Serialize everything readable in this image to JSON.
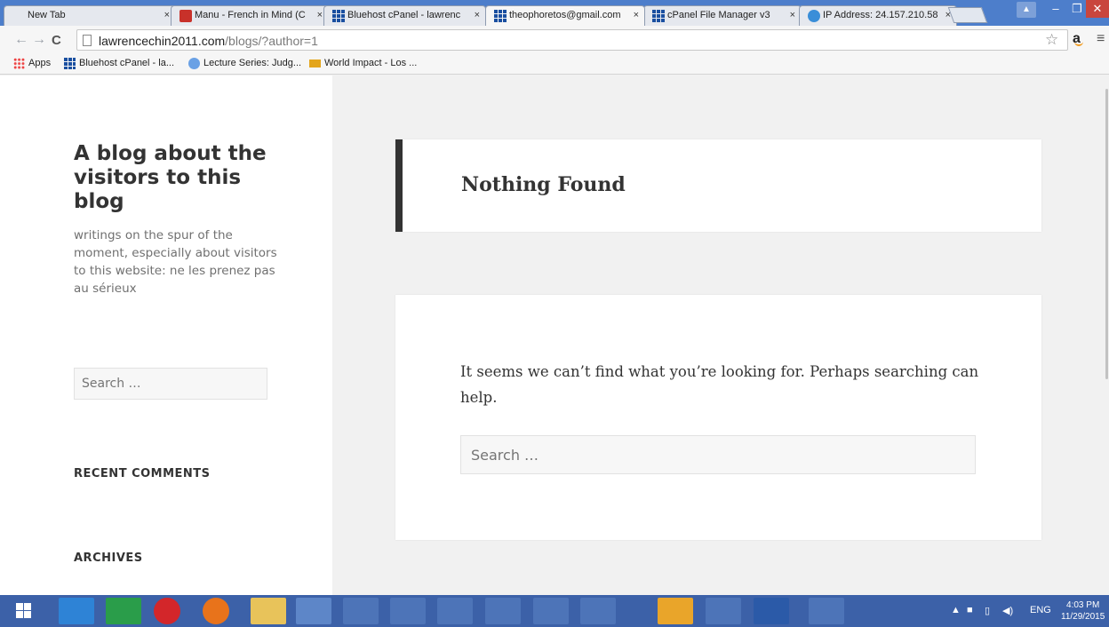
{
  "browser": {
    "tabs": [
      {
        "title": "New Tab",
        "favicon": "none"
      },
      {
        "title": "Manu - French in Mind (C",
        "favicon": "red-banner-icon"
      },
      {
        "title": "Bluehost cPanel - lawrenc",
        "favicon": "grid-icon"
      },
      {
        "title": "theophoretos@gmail.com",
        "favicon": "grid-icon"
      },
      {
        "title": "cPanel File Manager v3",
        "favicon": "grid-icon"
      },
      {
        "title": "IP Address: 24.157.210.58",
        "favicon": "globe-icon"
      }
    ],
    "close_glyph": "×",
    "url_host": "lawrencechin2011.com",
    "url_path": "/blogs/?author=1",
    "bookmarks": [
      {
        "label": "Apps"
      },
      {
        "label": "Bluehost cPanel - la..."
      },
      {
        "label": "Lecture Series: Judg..."
      },
      {
        "label": "World Impact - Los ..."
      }
    ]
  },
  "sidebar": {
    "site_title": "A blog about the visitors to this blog",
    "site_description": "writings on the spur of the moment, especially about visitors to this website: ne les prenez pas au sérieux",
    "search_placeholder": "Search …",
    "widget_recent_comments": "RECENT COMMENTS",
    "widget_archives": "ARCHIVES"
  },
  "main": {
    "page_title": "Nothing Found",
    "message": "It seems we can’t find what you’re looking for. Perhaps searching can help.",
    "search_placeholder": "Search …"
  },
  "taskbar": {
    "language": "ENG",
    "time": "4:03 PM",
    "date": "11/29/2015"
  }
}
